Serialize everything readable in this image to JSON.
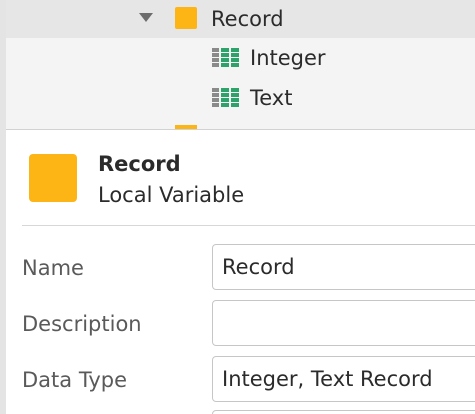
{
  "tree": {
    "items": [
      {
        "label": "Record",
        "icon": "record-icon",
        "expanded": true,
        "selected": true
      },
      {
        "label": "Integer",
        "icon": "grid-field-icon"
      },
      {
        "label": "Text",
        "icon": "grid-field-icon"
      }
    ]
  },
  "details": {
    "title": "Record",
    "subtitle": "Local Variable",
    "fields": [
      {
        "label": "Name",
        "value": "Record"
      },
      {
        "label": "Description",
        "value": ""
      },
      {
        "label": "Data Type",
        "value": "Integer, Text Record"
      }
    ]
  },
  "colors": {
    "record": "#fdb415",
    "grid_icon": "#2ea26b",
    "selected_row": "#e6e6e6",
    "tree_bg": "#f4f4f4"
  }
}
